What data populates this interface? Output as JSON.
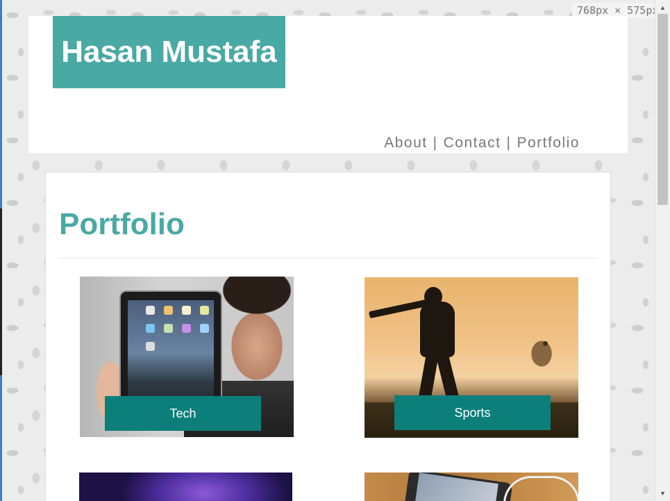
{
  "viewport": {
    "size_label": "768px  ×  575px"
  },
  "header": {
    "site_title": "Hasan Mustafa",
    "nav": [
      {
        "label": "About"
      },
      {
        "label": "Contact"
      },
      {
        "label": "Portfolio"
      }
    ],
    "nav_separator": "|"
  },
  "main": {
    "page_title": "Portfolio",
    "portfolio_items": [
      {
        "label": "Tech",
        "image": "tablet-photo"
      },
      {
        "label": "Sports",
        "image": "cricket-silhouette-photo"
      },
      {
        "label": "",
        "image": "purple-space-photo"
      },
      {
        "label": "",
        "image": "smartphone-photo"
      }
    ]
  },
  "colors": {
    "accent": "#49a9a4",
    "label_bg": "#0c7f7b",
    "nav_text": "#777777"
  },
  "scrollbar": {
    "up_icon": "arrow-up-icon",
    "down_icon": "arrow-down-icon"
  }
}
